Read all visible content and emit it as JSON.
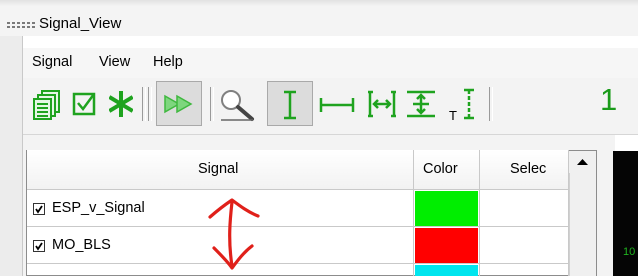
{
  "window": {
    "title": "Signal_View"
  },
  "menu": {
    "items": [
      "Signal",
      "View",
      "Help"
    ]
  },
  "toolbar": {
    "icons": [
      "copy-pages-icon",
      "checkbox-icon",
      "asterisk-icon",
      "play-forward-icon",
      "zoom-icon",
      "vertical-cursor-icon",
      "horizontal-measure-icon",
      "fit-horizontal-icon",
      "fit-vertical-icon",
      "vertical-text-cursor-icon"
    ],
    "trailing_text": "1",
    "icon_color": "#1fa31f"
  },
  "grid": {
    "columns": [
      "Signal",
      "Color",
      "Selec"
    ],
    "rows": [
      {
        "checked": true,
        "name": "ESP_v_Signal",
        "color": "#00ee00"
      },
      {
        "checked": true,
        "name": "MO_BLS",
        "color": "#ff0000"
      },
      {
        "checked": false,
        "name": "",
        "color": "#00e5ee"
      }
    ]
  },
  "side_panel": {
    "visible_digits": "10",
    "digit_color": "#1fb51f",
    "background": "#050505"
  },
  "annotation": {
    "icon": "double-arrow-annotation-icon",
    "color": "#e0201a"
  }
}
